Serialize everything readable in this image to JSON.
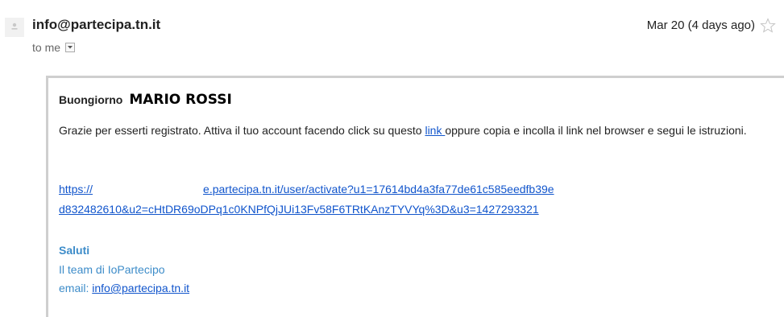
{
  "message": {
    "sender": "info@partecipa.tn.it",
    "recipient_label": "to me",
    "date": "Mar 20 (4 days ago)"
  },
  "body": {
    "greeting_word": "Buongiorno",
    "greeting_name": "MARIO ROSSI",
    "paragraph_before_link": "Grazie per esserti registrato. Attiva il tuo account facendo click su questo ",
    "link_text": "link ",
    "paragraph_after_link": "oppure copia e incolla il link nel browser e segui le istruzioni.",
    "url_line1_start": "https://",
    "url_line1_end": "e.partecipa.tn.it/user/activate?u1=17614bd4a3fa77de61c585eedfb39e",
    "url_line2": "d832482610&u2=cHtDR69oDPq1c0KNPfQjJUi13Fv58F6TRtKAnzTYVYq%3D&u3=1427293321"
  },
  "signature": {
    "title": "Saluti",
    "team": "Il team di IoPartecipo",
    "email_label": "email: ",
    "email": "info@partecipa.tn.it"
  },
  "icons": {
    "avatar": "person-icon",
    "dropdown": "chevron-down-icon",
    "star": "star-icon"
  },
  "colors": {
    "link": "#1155cc",
    "signature": "#3d8cc9",
    "border": "#cfcfcf"
  }
}
